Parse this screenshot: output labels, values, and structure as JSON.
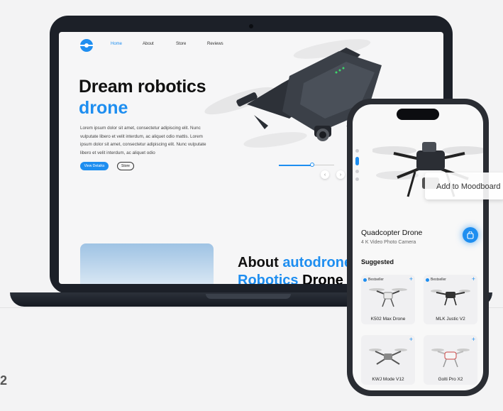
{
  "website": {
    "nav": [
      "Home",
      "About",
      "Store",
      "Reviews"
    ],
    "hero_title_line1": "Dream robotics",
    "hero_title_line2": "drone",
    "hero_description": "Lorem ipsum dolor sit amet, consectetur adipiscing elit. Nunc vulputate libero et velit interdum, ac aliquet odio mattis. Lorem ipsum dolor sit amet, consectetur adipiscing elit. Nunc vulputate libero et velit interdum, ac aliquet odio",
    "primary_button": "View Detaiks",
    "secondary_button": "Store",
    "about_title_part1": "About ",
    "about_title_part2": "autodrone",
    "about_title2_part1": "Robotics",
    "about_title2_part2": " Drone",
    "slider_progress": 0.62
  },
  "phone": {
    "product_name": "Quadcopter Drone",
    "product_meta": "4 K Video  Photo Camera",
    "suggested_label": "Suggested",
    "tooltip": "Add to Moodboard",
    "cards": [
      {
        "name": "K502 Max Drone",
        "badge": "Bestseller"
      },
      {
        "name": "MLK Justic V2",
        "badge": "Bestseller"
      },
      {
        "name": "KWJ Mode V12",
        "badge": ""
      },
      {
        "name": "Golti Pro X2",
        "badge": ""
      }
    ]
  },
  "page_number": "2",
  "colors": {
    "accent": "#1e8ef0",
    "device": "#1c2028",
    "background": "#f3f3f4"
  }
}
